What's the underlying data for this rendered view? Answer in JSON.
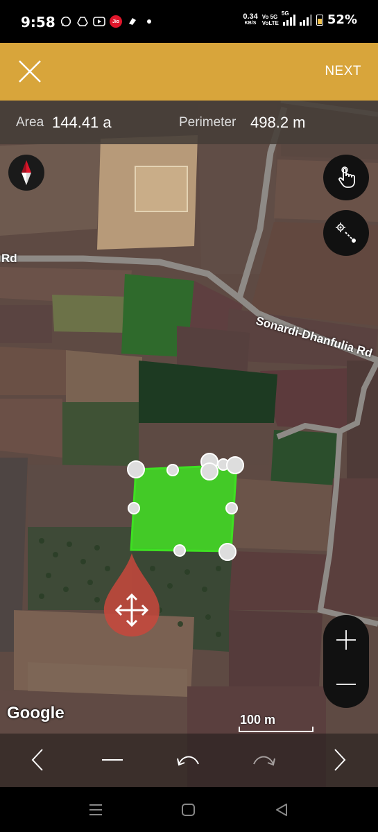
{
  "status_bar": {
    "time": "9:58",
    "carrier_badge": "Jio",
    "net_speed_value": "0.34",
    "net_speed_unit": "KB/S",
    "volte_line1": "Vo 5G",
    "volte_line2": "VoLTE",
    "network_type": "5G",
    "battery_percent": "52%",
    "battery_level": 0.52,
    "icons": [
      "whatsapp-icon",
      "drive-icon",
      "youtube-icon",
      "jio-icon",
      "tea-icon",
      "dot-icon"
    ]
  },
  "app_bar": {
    "close_icon": "close-icon",
    "next_label": "NEXT",
    "color": "#d8a53b"
  },
  "info": {
    "area_label": "Area",
    "area_value": "144.41 a",
    "perimeter_label": "Perimeter",
    "perimeter_value": "498.2 m"
  },
  "map": {
    "road_label_left": "Rd",
    "road_label_main": "Sonardi-Dhanfulia Rd",
    "polygon_color": "#3ee022",
    "marker_color": "#c8483c",
    "attribution": "Google",
    "scale_label": "100 m",
    "controls": {
      "compass": "compass-icon",
      "touch_mode": "hand-pointer-icon",
      "point_mode": "gps-walk-icon",
      "zoom_in": "plus-icon",
      "zoom_out": "minus-icon"
    }
  },
  "toolbar": {
    "prev": "chevron-left-icon",
    "delete": "minus-icon",
    "undo": "undo-icon",
    "redo": "redo-icon",
    "next": "chevron-right-icon"
  },
  "nav_bar": {
    "recents": "recents-icon",
    "home": "home-icon",
    "back": "back-icon"
  }
}
